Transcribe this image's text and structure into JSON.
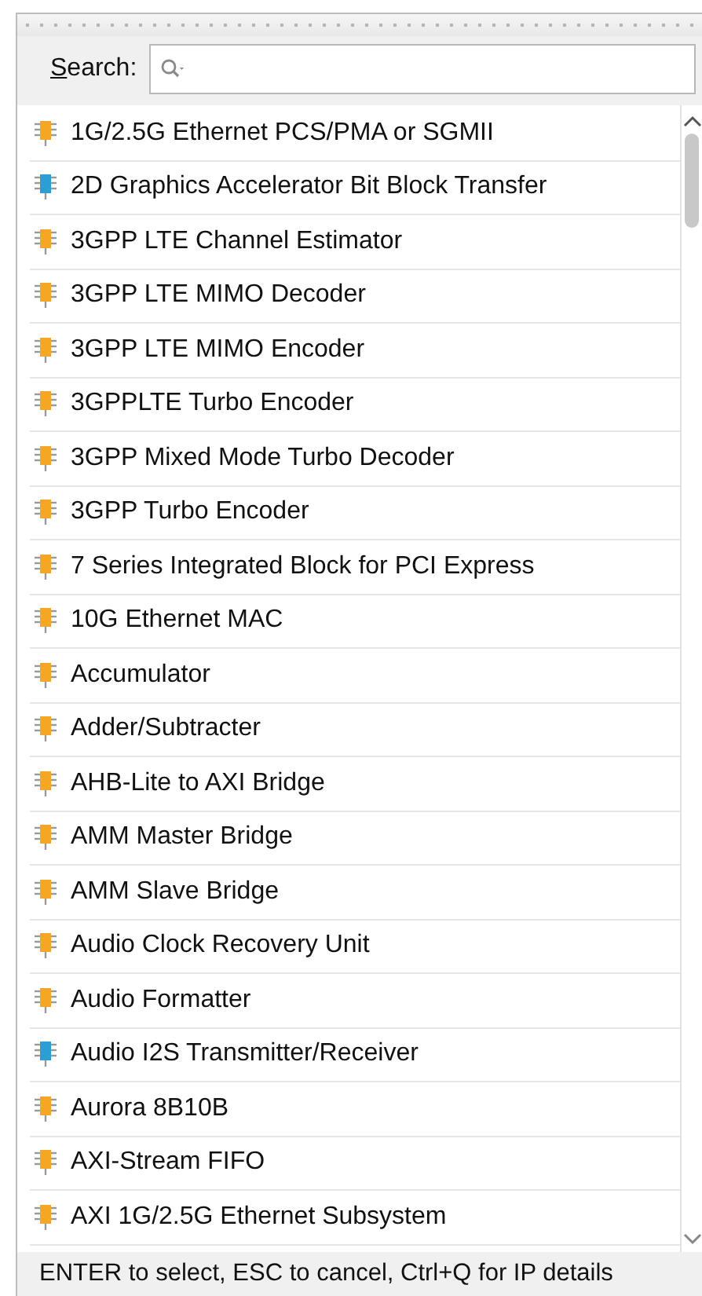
{
  "search": {
    "label": "Search:"
  },
  "items": [
    {
      "name": "1G/2.5G Ethernet PCS/PMA or SGMII",
      "color": "#f5a623"
    },
    {
      "name": "2D Graphics Accelerator Bit Block Transfer",
      "color": "#2a9fd6"
    },
    {
      "name": "3GPP LTE Channel Estimator",
      "color": "#f5a623"
    },
    {
      "name": "3GPP LTE MIMO Decoder",
      "color": "#f5a623"
    },
    {
      "name": "3GPP LTE MIMO Encoder",
      "color": "#f5a623"
    },
    {
      "name": "3GPPLTE Turbo Encoder",
      "color": "#f5a623"
    },
    {
      "name": "3GPP Mixed Mode Turbo Decoder",
      "color": "#f5a623"
    },
    {
      "name": "3GPP Turbo Encoder",
      "color": "#f5a623"
    },
    {
      "name": "7 Series Integrated Block for PCI Express",
      "color": "#f5a623"
    },
    {
      "name": "10G Ethernet MAC",
      "color": "#f5a623"
    },
    {
      "name": "Accumulator",
      "color": "#f5a623"
    },
    {
      "name": "Adder/Subtracter",
      "color": "#f5a623"
    },
    {
      "name": "AHB-Lite to AXI Bridge",
      "color": "#f5a623"
    },
    {
      "name": "AMM Master Bridge",
      "color": "#f5a623"
    },
    {
      "name": "AMM Slave Bridge",
      "color": "#f5a623"
    },
    {
      "name": "Audio Clock Recovery Unit",
      "color": "#f5a623"
    },
    {
      "name": "Audio Formatter",
      "color": "#f5a623"
    },
    {
      "name": "Audio I2S Transmitter/Receiver",
      "color": "#2a9fd6"
    },
    {
      "name": "Aurora 8B10B",
      "color": "#f5a623"
    },
    {
      "name": "AXI-Stream FIFO",
      "color": "#f5a623"
    },
    {
      "name": "AXI 1G/2.5G Ethernet Subsystem",
      "color": "#f5a623"
    }
  ],
  "status_bar": "ENTER to select, ESC to cancel, Ctrl+Q for IP details"
}
